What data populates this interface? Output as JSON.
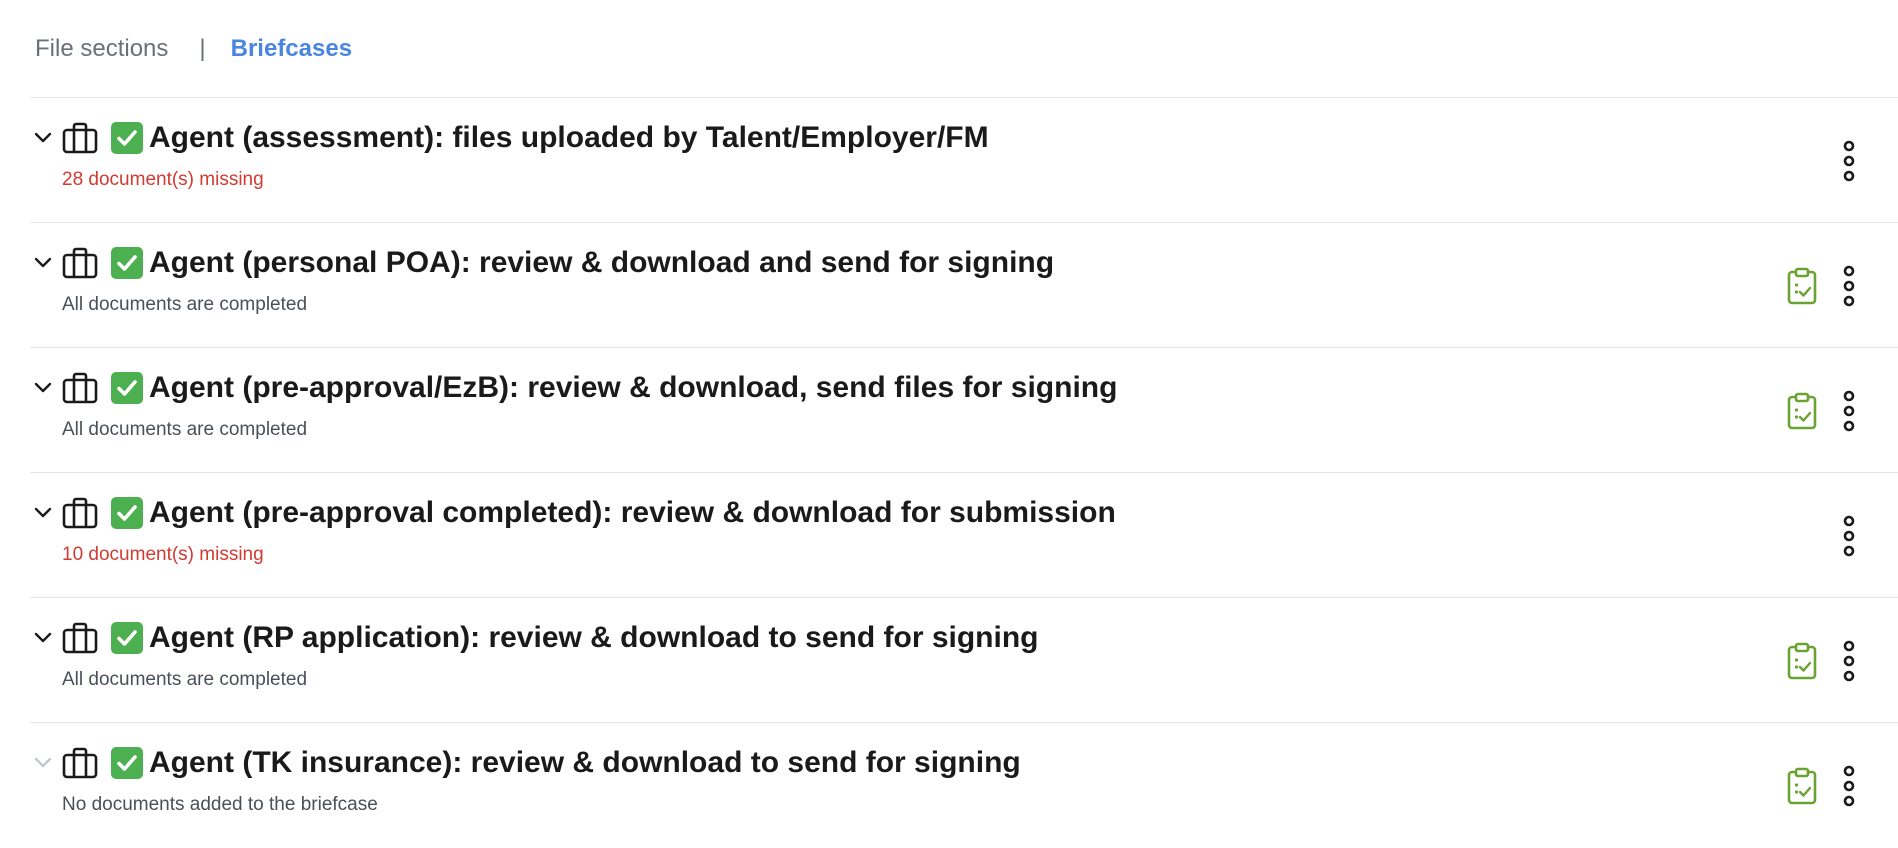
{
  "tabs": {
    "file_sections": "File sections",
    "separator": "|",
    "briefcases": "Briefcases",
    "active": "Briefcases"
  },
  "colors": {
    "accent": "#4a86e0",
    "missing": "#d23a32",
    "check_green": "#4caf50",
    "clipboard_green": "#6aa332"
  },
  "icons": {
    "expand": "chevron-down-icon",
    "briefcase": "briefcase-icon",
    "check": "check-mark-button-icon",
    "clipboard": "clipboard-check-icon",
    "more": "more-vertical-icon"
  },
  "briefcases": [
    {
      "title": "Agent (assessment): files uploaded by Talent/Employer/FM",
      "status": "28 document(s) missing",
      "status_type": "missing",
      "has_clipboard": false,
      "expandable": true
    },
    {
      "title": "Agent (personal POA): review & download and send for signing",
      "status": "All documents are completed",
      "status_type": "ok",
      "has_clipboard": true,
      "expandable": true
    },
    {
      "title": "Agent (pre-approval/EzB): review & download, send files for signing",
      "status": "All documents are completed",
      "status_type": "ok",
      "has_clipboard": true,
      "expandable": true
    },
    {
      "title": "Agent (pre-approval completed): review & download for submission",
      "status": "10 document(s) missing",
      "status_type": "missing",
      "has_clipboard": false,
      "expandable": true
    },
    {
      "title": "Agent (RP application): review & download to send for signing",
      "status": "All documents are completed",
      "status_type": "ok",
      "has_clipboard": true,
      "expandable": true
    },
    {
      "title": "Agent (TK insurance): review & download to send for signing",
      "status": "No documents added to the briefcase",
      "status_type": "ok",
      "has_clipboard": true,
      "expandable": false
    }
  ]
}
